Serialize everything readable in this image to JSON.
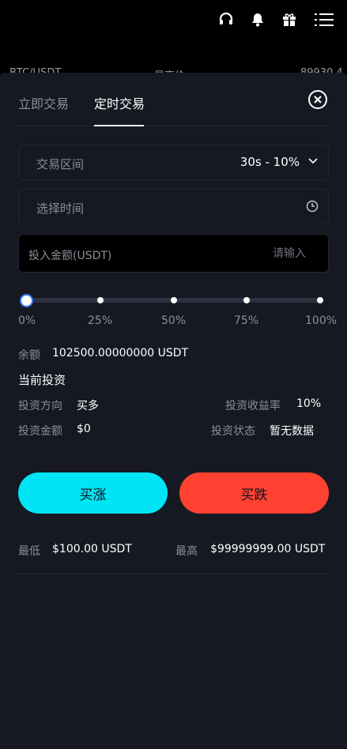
{
  "header": {
    "icons": [
      "headset-icon",
      "bell-icon",
      "gift-icon",
      "menu-icon"
    ],
    "peek_row": [
      "BTC/USDT",
      "最高价",
      "89930.4"
    ]
  },
  "tabs": {
    "instant": "立即交易",
    "scheduled": "定时交易"
  },
  "form": {
    "interval_label": "交易区间",
    "interval_value": "30s - 10%",
    "time_label": "选择时间",
    "amount_label": "投入金额(USDT)",
    "amount_placeholder": "请输入"
  },
  "slider": {
    "value_percent": 0,
    "labels": [
      "0%",
      "25%",
      "50%",
      "75%",
      "100%"
    ]
  },
  "balance": {
    "label": "余额",
    "value": "102500.00000000 USDT"
  },
  "current_investment": {
    "title": "当前投资",
    "direction_label": "投资方向",
    "direction_value": "买多",
    "return_label": "投资收益率",
    "return_value": "10%",
    "amount_label": "投资金额",
    "amount_value": "$0",
    "status_label": "投资状态",
    "status_value": "暂无数据"
  },
  "actions": {
    "buy_up": "买涨",
    "buy_down": "买跌"
  },
  "limits": {
    "min_label": "最低",
    "min_value": "$100.00 USDT",
    "max_label": "最高",
    "max_value": "$99999999.00 USDT"
  },
  "colors": {
    "buy_up": "#00e5f5",
    "buy_down": "#ff4132",
    "sheet_bg": "#161922",
    "slider_handle_border": "#2f7af0"
  }
}
